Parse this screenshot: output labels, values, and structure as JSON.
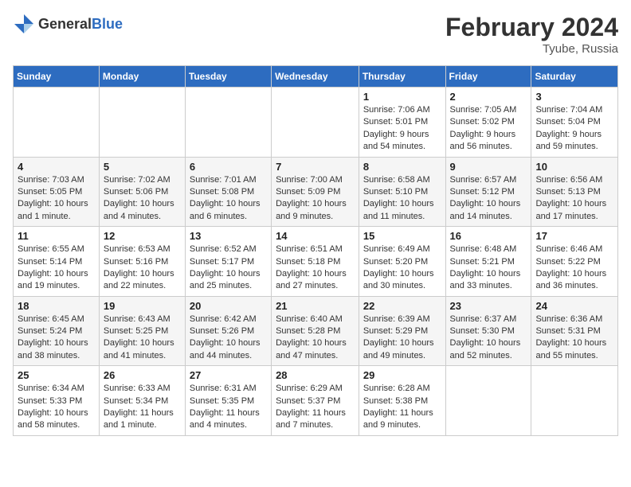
{
  "header": {
    "logo": {
      "general": "General",
      "blue": "Blue"
    },
    "month": "February 2024",
    "location": "Tyube, Russia"
  },
  "weekdays": [
    "Sunday",
    "Monday",
    "Tuesday",
    "Wednesday",
    "Thursday",
    "Friday",
    "Saturday"
  ],
  "weeks": [
    [
      {
        "day": "",
        "details": ""
      },
      {
        "day": "",
        "details": ""
      },
      {
        "day": "",
        "details": ""
      },
      {
        "day": "",
        "details": ""
      },
      {
        "day": "1",
        "details": "Sunrise: 7:06 AM\nSunset: 5:01 PM\nDaylight: 9 hours\nand 54 minutes."
      },
      {
        "day": "2",
        "details": "Sunrise: 7:05 AM\nSunset: 5:02 PM\nDaylight: 9 hours\nand 56 minutes."
      },
      {
        "day": "3",
        "details": "Sunrise: 7:04 AM\nSunset: 5:04 PM\nDaylight: 9 hours\nand 59 minutes."
      }
    ],
    [
      {
        "day": "4",
        "details": "Sunrise: 7:03 AM\nSunset: 5:05 PM\nDaylight: 10 hours\nand 1 minute."
      },
      {
        "day": "5",
        "details": "Sunrise: 7:02 AM\nSunset: 5:06 PM\nDaylight: 10 hours\nand 4 minutes."
      },
      {
        "day": "6",
        "details": "Sunrise: 7:01 AM\nSunset: 5:08 PM\nDaylight: 10 hours\nand 6 minutes."
      },
      {
        "day": "7",
        "details": "Sunrise: 7:00 AM\nSunset: 5:09 PM\nDaylight: 10 hours\nand 9 minutes."
      },
      {
        "day": "8",
        "details": "Sunrise: 6:58 AM\nSunset: 5:10 PM\nDaylight: 10 hours\nand 11 minutes."
      },
      {
        "day": "9",
        "details": "Sunrise: 6:57 AM\nSunset: 5:12 PM\nDaylight: 10 hours\nand 14 minutes."
      },
      {
        "day": "10",
        "details": "Sunrise: 6:56 AM\nSunset: 5:13 PM\nDaylight: 10 hours\nand 17 minutes."
      }
    ],
    [
      {
        "day": "11",
        "details": "Sunrise: 6:55 AM\nSunset: 5:14 PM\nDaylight: 10 hours\nand 19 minutes."
      },
      {
        "day": "12",
        "details": "Sunrise: 6:53 AM\nSunset: 5:16 PM\nDaylight: 10 hours\nand 22 minutes."
      },
      {
        "day": "13",
        "details": "Sunrise: 6:52 AM\nSunset: 5:17 PM\nDaylight: 10 hours\nand 25 minutes."
      },
      {
        "day": "14",
        "details": "Sunrise: 6:51 AM\nSunset: 5:18 PM\nDaylight: 10 hours\nand 27 minutes."
      },
      {
        "day": "15",
        "details": "Sunrise: 6:49 AM\nSunset: 5:20 PM\nDaylight: 10 hours\nand 30 minutes."
      },
      {
        "day": "16",
        "details": "Sunrise: 6:48 AM\nSunset: 5:21 PM\nDaylight: 10 hours\nand 33 minutes."
      },
      {
        "day": "17",
        "details": "Sunrise: 6:46 AM\nSunset: 5:22 PM\nDaylight: 10 hours\nand 36 minutes."
      }
    ],
    [
      {
        "day": "18",
        "details": "Sunrise: 6:45 AM\nSunset: 5:24 PM\nDaylight: 10 hours\nand 38 minutes."
      },
      {
        "day": "19",
        "details": "Sunrise: 6:43 AM\nSunset: 5:25 PM\nDaylight: 10 hours\nand 41 minutes."
      },
      {
        "day": "20",
        "details": "Sunrise: 6:42 AM\nSunset: 5:26 PM\nDaylight: 10 hours\nand 44 minutes."
      },
      {
        "day": "21",
        "details": "Sunrise: 6:40 AM\nSunset: 5:28 PM\nDaylight: 10 hours\nand 47 minutes."
      },
      {
        "day": "22",
        "details": "Sunrise: 6:39 AM\nSunset: 5:29 PM\nDaylight: 10 hours\nand 49 minutes."
      },
      {
        "day": "23",
        "details": "Sunrise: 6:37 AM\nSunset: 5:30 PM\nDaylight: 10 hours\nand 52 minutes."
      },
      {
        "day": "24",
        "details": "Sunrise: 6:36 AM\nSunset: 5:31 PM\nDaylight: 10 hours\nand 55 minutes."
      }
    ],
    [
      {
        "day": "25",
        "details": "Sunrise: 6:34 AM\nSunset: 5:33 PM\nDaylight: 10 hours\nand 58 minutes."
      },
      {
        "day": "26",
        "details": "Sunrise: 6:33 AM\nSunset: 5:34 PM\nDaylight: 11 hours\nand 1 minute."
      },
      {
        "day": "27",
        "details": "Sunrise: 6:31 AM\nSunset: 5:35 PM\nDaylight: 11 hours\nand 4 minutes."
      },
      {
        "day": "28",
        "details": "Sunrise: 6:29 AM\nSunset: 5:37 PM\nDaylight: 11 hours\nand 7 minutes."
      },
      {
        "day": "29",
        "details": "Sunrise: 6:28 AM\nSunset: 5:38 PM\nDaylight: 11 hours\nand 9 minutes."
      },
      {
        "day": "",
        "details": ""
      },
      {
        "day": "",
        "details": ""
      }
    ]
  ]
}
